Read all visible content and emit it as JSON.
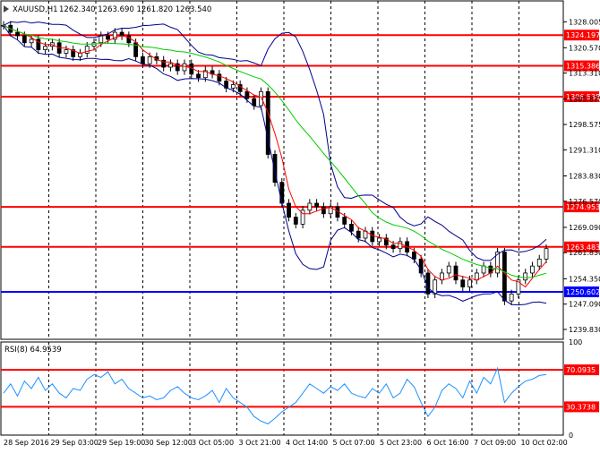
{
  "header": {
    "symbol": "XAUUSD,H1",
    "ohlc": "1262.340 1263.690 1261.820 1263.540"
  },
  "rsi_label": "RSI(8) 64.9539",
  "price_axis": {
    "ticks": [
      "1328.005",
      "1320.570",
      "1313.310",
      "1305.875",
      "1298.575",
      "1291.310",
      "1283.830",
      "1276.570",
      "1269.090",
      "1261.830",
      "1254.350",
      "1247.090",
      "1239.830"
    ]
  },
  "rsi_axis": {
    "ticks": [
      "100",
      "0"
    ]
  },
  "time_axis": {
    "labels": [
      "28 Sep 2016",
      "29 Sep 03:00",
      "29 Sep 19:00",
      "30 Sep 12:00",
      "3 Oct 05:00",
      "3 Oct 21:00",
      "4 Oct 14:00",
      "5 Oct 07:00",
      "5 Oct 23:00",
      "6 Oct 16:00",
      "7 Oct 09:00",
      "10 Oct 02:00"
    ]
  },
  "levels": [
    {
      "label": "1324.197",
      "price": 1324.197,
      "color": "#ff0000"
    },
    {
      "label": "1315.386",
      "price": 1315.386,
      "color": "#ff0000"
    },
    {
      "label": "1306.538",
      "price": 1306.538,
      "color": "#ff0000"
    },
    {
      "label": "1274.953",
      "price": 1274.953,
      "color": "#ff0000"
    },
    {
      "label": "1263.483",
      "price": 1263.483,
      "color": "#ff0000"
    },
    {
      "label": "1250.602",
      "price": 1250.602,
      "color": "#0000ff"
    }
  ],
  "rsi_levels": [
    {
      "label": "70.0935",
      "value": 70.0935,
      "color": "#ff0000"
    },
    {
      "label": "30.3738",
      "value": 30.3738,
      "color": "#ff0000"
    }
  ],
  "colors": {
    "candles": "#000000",
    "grid": "#000000",
    "bollinger": "#00008b",
    "ma_fast": "#ff0000",
    "ma_slow": "#00cc00",
    "rsi": "#1e90ff"
  },
  "chart_data": {
    "type": "line",
    "close_series": [
      1327,
      1325,
      1324,
      1322,
      1323,
      1320,
      1321,
      1322,
      1319,
      1320,
      1318,
      1319,
      1321,
      1322,
      1324,
      1323,
      1325,
      1324,
      1322,
      1318,
      1316,
      1318,
      1317,
      1315,
      1316,
      1314,
      1316,
      1313,
      1312,
      1314,
      1313,
      1311,
      1309,
      1310,
      1308,
      1306,
      1304,
      1308,
      1290,
      1282,
      1276,
      1272,
      1270,
      1274,
      1276,
      1275,
      1273,
      1275,
      1272,
      1270,
      1268,
      1266,
      1268,
      1265,
      1266,
      1264,
      1263,
      1265,
      1262,
      1260,
      1256,
      1250,
      1254,
      1256,
      1258,
      1254,
      1252,
      1254,
      1256,
      1258,
      1256,
      1262,
      1248,
      1250,
      1254,
      1256,
      1258,
      1260,
      1263
    ],
    "rsi_series": [
      45,
      55,
      42,
      58,
      50,
      62,
      48,
      55,
      45,
      40,
      50,
      48,
      60,
      65,
      62,
      68,
      55,
      60,
      50,
      45,
      40,
      42,
      38,
      40,
      48,
      52,
      45,
      40,
      38,
      42,
      48,
      35,
      50,
      40,
      35,
      30,
      20,
      15,
      12,
      18,
      25,
      30,
      35,
      45,
      55,
      50,
      45,
      52,
      48,
      55,
      45,
      42,
      40,
      50,
      45,
      55,
      40,
      45,
      60,
      52,
      35,
      20,
      30,
      48,
      55,
      50,
      40,
      58,
      45,
      62,
      55,
      72,
      35,
      45,
      52,
      58,
      60,
      64,
      65
    ],
    "price_range": [
      1237,
      1334
    ],
    "rsi_range": [
      0,
      100
    ]
  }
}
